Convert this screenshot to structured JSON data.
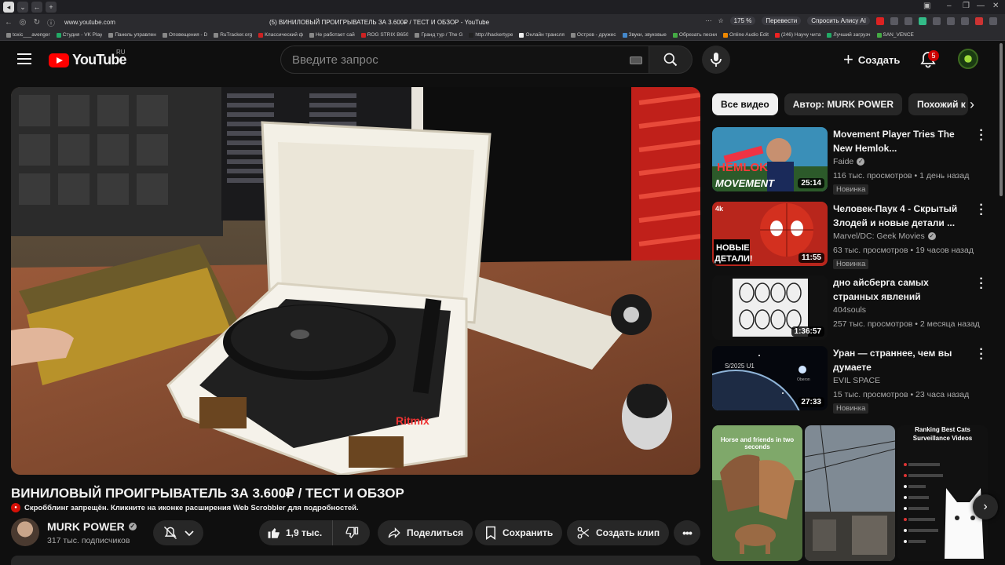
{
  "browser": {
    "url": "www.youtube.com",
    "document_title": "(5) ВИНИЛОВЫЙ ПРОИГРЫВАТЕЛЬ ЗА 3.600₽ / ТЕСТ И ОБЗОР - YouTube",
    "zoom": "175 %",
    "translate_label": "Перевести",
    "alice_label": "Спросить Алису AI",
    "bookmarks": [
      "toxic___avenger",
      "Студия - VK Play",
      "Панель управлен",
      "Оповещения - D",
      "RuTracker.org",
      "Классический ф",
      "Не работает сай",
      "ROG STRIX B650",
      "Гранд тур / The G",
      "http://hackertype",
      "Онлайн трансля",
      "Остров - дружес",
      "Звуки, звуковые",
      "Обрезать песни",
      "Online Audio Edit",
      "(246) Научу чита",
      "Лучший загрузч",
      "SAN_VENCE"
    ]
  },
  "header": {
    "logo_text": "YouTube",
    "logo_region": "RU",
    "search_placeholder": "Введите запрос",
    "create_label": "Создать",
    "notification_count": "5"
  },
  "video": {
    "title": "ВИНИЛОВЫЙ ПРОИГРЫВАТЕЛЬ ЗА 3.600₽ / ТЕСТ И ОБЗОР",
    "scrobbler_note": "Скробблинг запрещён. Кликните на иконке расширения Web Scrobbler для подробностей.",
    "channel_name": "MURK POWER",
    "subscribers": "317 тыс. подписчиков",
    "likes": "1,9 тыс.",
    "share_label": "Поделиться",
    "save_label": "Сохранить",
    "clip_label": "Создать клип",
    "thumb_caption": "Ritmix"
  },
  "chips": [
    "Все видео",
    "Автор: MURK POWER",
    "Похожий к"
  ],
  "recommendations": [
    {
      "title": "Movement Player Tries The New Hemlok...",
      "channel": "Faide",
      "verified": true,
      "meta": "116 тыс. просмотров • 1 день назад",
      "badge": "Новинка",
      "duration": "25:14",
      "thumb_text_1": "HEMLOK",
      "thumb_text_2": "MOVEMENT"
    },
    {
      "title": "Человек-Паук 4 - Скрытый Злодей и новые детали ...",
      "channel": "Marvel/DC: Geek Movies",
      "verified": true,
      "meta": "63 тыс. просмотров • 19 часов назад",
      "badge": "Новинка",
      "duration": "11:55",
      "thumb_text_1": "НОВЫЕ",
      "thumb_text_2": "ДЕТАЛИ!",
      "thumb_corner": "4k"
    },
    {
      "title": "дно айсберга самых странных явлений",
      "channel": "404souls",
      "verified": false,
      "meta": "257 тыс. просмотров • 2 месяца назад",
      "badge": "",
      "duration": "1:36:57"
    },
    {
      "title": "Уран — страннее, чем вы думаете",
      "channel": "EVIL SPACE",
      "verified": false,
      "meta": "15 тыс. просмотров • 23 часа назад",
      "badge": "Новинка",
      "duration": "27:33",
      "thumb_text_1": "S/2025 U1",
      "thumb_text_2": "Oberon"
    }
  ],
  "shorts": [
    {
      "caption": "Horse and friends in two seconds"
    },
    {
      "caption": ""
    },
    {
      "caption": "Ranking Best Cats Surveillance Videos"
    }
  ],
  "colors": {
    "background": "#0f0f0f",
    "chip": "#272727",
    "brand_red": "#ff0000",
    "muted_text": "#aaaaaa"
  }
}
